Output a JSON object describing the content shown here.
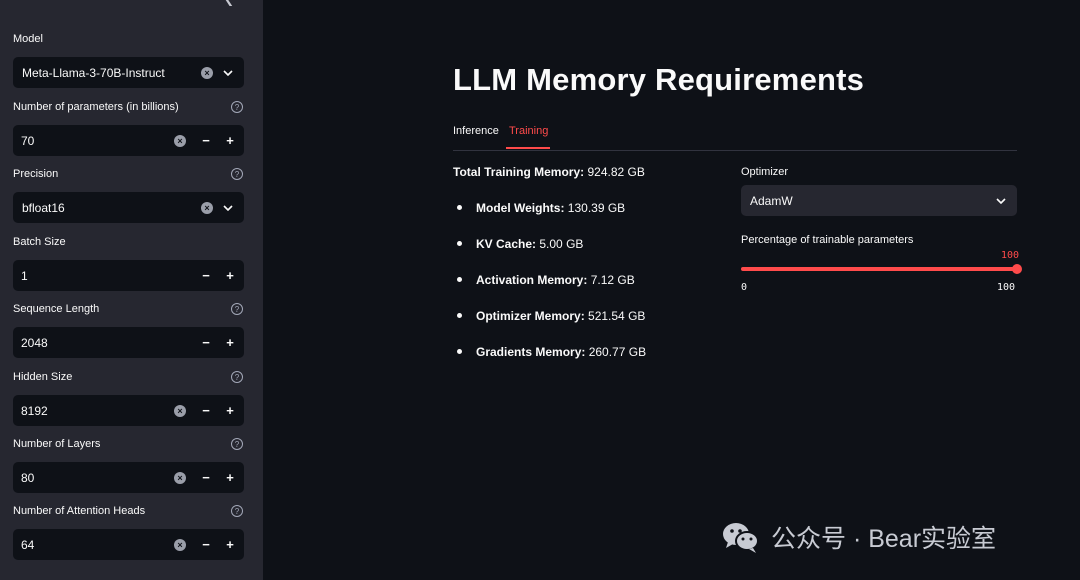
{
  "sidebar": {
    "fields": [
      {
        "label": "Model",
        "value": "Meta-Llama-3-70B-Instruct",
        "kind": "select",
        "help": false,
        "clear": true
      },
      {
        "label": "Number of parameters (in billions)",
        "value": "70",
        "kind": "number",
        "help": true,
        "clear": true
      },
      {
        "label": "Precision",
        "value": "bfloat16",
        "kind": "select",
        "help": true,
        "clear": true
      },
      {
        "label": "Batch Size",
        "value": "1",
        "kind": "number",
        "help": false,
        "clear": false
      },
      {
        "label": "Sequence Length",
        "value": "2048",
        "kind": "number",
        "help": true,
        "clear": false
      },
      {
        "label": "Hidden Size",
        "value": "8192",
        "kind": "number",
        "help": true,
        "clear": true
      },
      {
        "label": "Number of Layers",
        "value": "80",
        "kind": "number",
        "help": true,
        "clear": true
      },
      {
        "label": "Number of Attention Heads",
        "value": "64",
        "kind": "number",
        "help": true,
        "clear": true
      }
    ]
  },
  "main": {
    "title": "LLM Memory Requirements",
    "tabs": [
      {
        "label": "Inference",
        "active": false
      },
      {
        "label": "Training",
        "active": true
      }
    ],
    "total": {
      "label": "Total Training Memory:",
      "value": "924.82 GB"
    },
    "items": [
      {
        "label": "Model Weights:",
        "value": "130.39 GB"
      },
      {
        "label": "KV Cache:",
        "value": "5.00 GB"
      },
      {
        "label": "Activation Memory:",
        "value": "7.12 GB"
      },
      {
        "label": "Optimizer Memory:",
        "value": "521.54 GB"
      },
      {
        "label": "Gradients Memory:",
        "value": "260.77 GB"
      }
    ],
    "optimizer": {
      "label": "Optimizer",
      "value": "AdamW"
    },
    "slider": {
      "label": "Percentage of trainable parameters",
      "value": "100",
      "min": "0",
      "max": "100",
      "fraction": 1.0
    }
  },
  "watermark": {
    "text": "公众号 · Bear实验室"
  },
  "colors": {
    "accent": "#ff4b4b",
    "sidebar_bg": "#262730",
    "main_bg": "#0e1117"
  }
}
